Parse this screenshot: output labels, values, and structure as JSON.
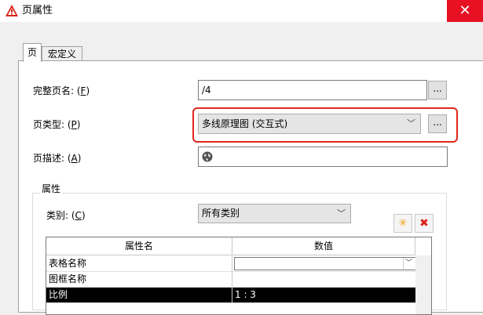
{
  "window": {
    "title": "页属性",
    "close_glyph": "✕"
  },
  "tabs": [
    {
      "label": "页",
      "active": true
    },
    {
      "label": "宏定义",
      "active": false
    }
  ],
  "fields": {
    "full_page_name": {
      "label_pre": "完整页名: (",
      "mnemonic": "F",
      "label_post": ")",
      "value": "/4"
    },
    "page_type": {
      "label_pre": "页类型: (",
      "mnemonic": "P",
      "label_post": ")",
      "value": "多线原理图 (交互式)"
    },
    "page_description": {
      "label_pre": "页描述: (",
      "mnemonic": "A",
      "label_post": ")",
      "value": ""
    }
  },
  "ellipsis_label": "...",
  "properties": {
    "group_title": "属性",
    "category": {
      "label_pre": "类别: (",
      "mnemonic": "C",
      "label_post": ")",
      "value": "所有类别"
    },
    "columns": [
      "属性名",
      "数值"
    ],
    "rows": [
      {
        "name": "表格名称",
        "value": ""
      },
      {
        "name": "图框名称",
        "value": ""
      },
      {
        "name": "比例",
        "value": "1 : 3"
      }
    ],
    "new_button_glyph": "✳",
    "delete_button_glyph": "✖"
  },
  "colors": {
    "highlight_border": "#e0281c",
    "close_button": "#e81123",
    "new_button": "#f5a623",
    "delete_button": "#d9251c"
  }
}
